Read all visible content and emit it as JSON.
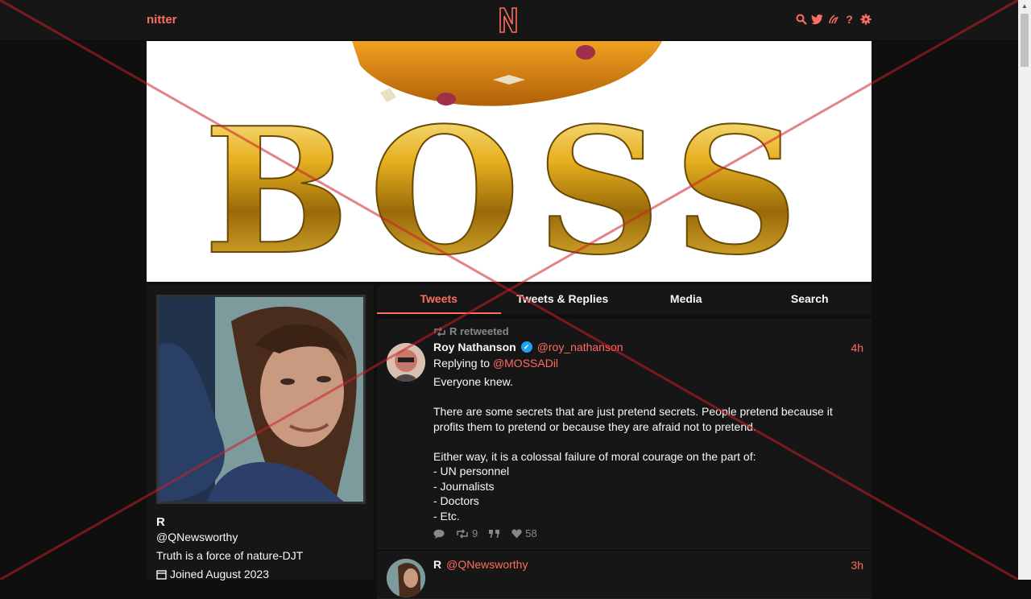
{
  "nav": {
    "brand": "nitter",
    "icons": [
      "search-icon",
      "twitter-icon",
      "rss-icon",
      "help-icon",
      "settings-icon"
    ],
    "help_glyph": "?"
  },
  "banner": {
    "text": "BOSS"
  },
  "profile": {
    "fullname": "R",
    "username": "@QNewsworthy",
    "bio": "Truth is a force of nature-DJT",
    "joined": "Joined August 2023"
  },
  "tabs": [
    {
      "label": "Tweets",
      "active": true
    },
    {
      "label": "Tweets & Replies",
      "active": false
    },
    {
      "label": "Media",
      "active": false
    },
    {
      "label": "Search",
      "active": false
    }
  ],
  "tweets": [
    {
      "retweet_header": "R retweeted",
      "fullname": "Roy Nathanson",
      "username": "@roy_nathanson",
      "date": "4h",
      "replying_label": "Replying to",
      "replying_to": "@MOSSADil",
      "body": "Everyone knew.\n\nThere are some secrets that are just pretend secrets. People pretend because it profits them to pretend or because they are afraid not to pretend.\n\nEither way, it is a colossal failure of moral courage on the part of:\n- UN personnel\n- Journalists\n- Doctors\n- Etc.",
      "retweets": "9",
      "likes": "58"
    },
    {
      "fullname": "R",
      "username": "@QNewsworthy",
      "date": "3h"
    }
  ],
  "colors": {
    "accent": "#ff6c60",
    "background": "#0f0f0f",
    "panel": "#161616"
  }
}
